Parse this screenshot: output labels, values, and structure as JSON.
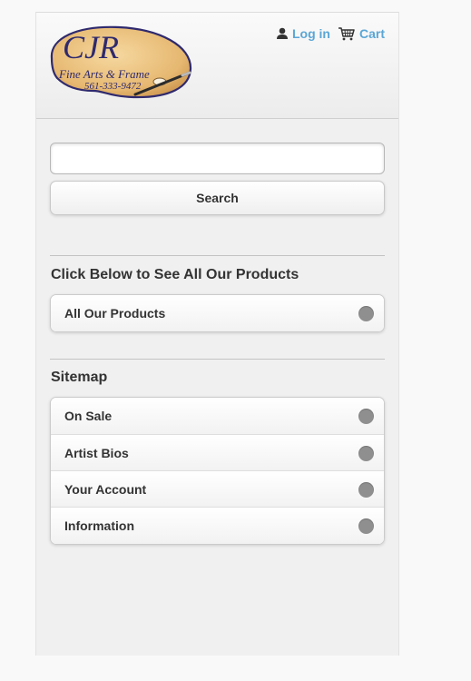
{
  "header": {
    "logo": {
      "brand": "CJR",
      "tagline": "Fine Arts & Frame",
      "phone": "561-333-9472"
    },
    "login_label": "Log in",
    "cart_label": "Cart",
    "link_color": "#5aa6d6"
  },
  "search": {
    "value": "",
    "placeholder": "",
    "button_label": "Search"
  },
  "products_section": {
    "heading": "Click Below to See All Our Products",
    "items": [
      {
        "label": "All Our Products",
        "icon": "arrow-r-icon"
      }
    ]
  },
  "sitemap_section": {
    "heading": "Sitemap",
    "items": [
      {
        "label": "On Sale",
        "icon": "arrow-r-icon"
      },
      {
        "label": "Artist Bios",
        "icon": "arrow-r-icon"
      },
      {
        "label": "Your Account",
        "icon": "arrow-r-icon"
      },
      {
        "label": "Information",
        "icon": "arrow-r-icon"
      }
    ]
  }
}
